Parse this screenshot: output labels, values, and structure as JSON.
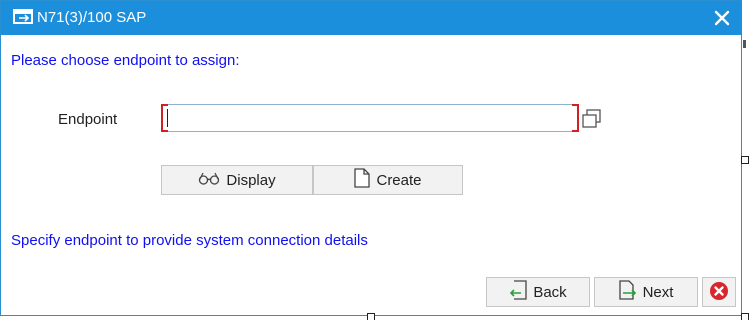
{
  "window": {
    "title": "N71(3)/100 SAP",
    "title_icon": "sap-window-icon",
    "close_icon": "close-icon",
    "accent_color": "#1c8fdc"
  },
  "form": {
    "prompt": "Please choose endpoint to assign:",
    "endpoint_label": "Endpoint",
    "endpoint_value": "",
    "endpoint_required": true,
    "value_help_icon": "copy-icon"
  },
  "actions": {
    "display_label": "Display",
    "display_icon": "glasses-icon",
    "create_label": "Create",
    "create_icon": "new-document-icon"
  },
  "hint": "Specify endpoint to provide system connection details",
  "footer": {
    "back_label": "Back",
    "back_icon": "back-arrow-icon",
    "next_label": "Next",
    "next_icon": "next-arrow-icon",
    "cancel_icon": "cancel-icon",
    "cancel_color": "#d9262c"
  },
  "colors": {
    "link_text": "#1010f0",
    "required_marker": "#d42020"
  }
}
